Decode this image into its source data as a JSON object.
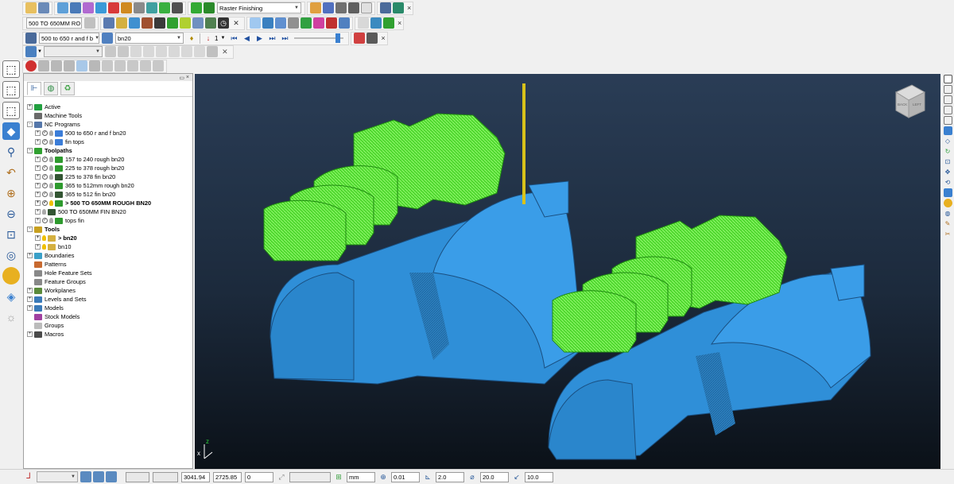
{
  "toolbar1": {
    "strategy_dropdown": "Raster Finishing"
  },
  "toolbar2": {
    "toolpath_dropdown": "500 TO 650MM RO"
  },
  "toolbar3": {
    "ncprogram_dropdown": "500 to 650 r and f b",
    "tool_dropdown": "bn20",
    "step_value": "1"
  },
  "explorer": {
    "tabs": [
      "explorer-tab",
      "web-tab",
      "recycle-tab"
    ],
    "tree": [
      {
        "label": "Active",
        "level": 0,
        "icon": "#22a040",
        "expander": "+"
      },
      {
        "label": "Machine Tools",
        "level": 0,
        "icon": "#6a6a6a",
        "expander": ""
      },
      {
        "label": "NC Programs",
        "level": 0,
        "icon": "#5577aa",
        "expander": "-"
      },
      {
        "label": "500 to 650 r and f bn20",
        "level": 1,
        "icon": "#3b7dd8",
        "expander": "+",
        "check": true,
        "bulb": false
      },
      {
        "label": "fin tops",
        "level": 1,
        "icon": "#3b7dd8",
        "expander": "+",
        "check": true,
        "bulb": false
      },
      {
        "label": "Toolpaths",
        "level": 0,
        "icon": "#30a030",
        "expander": "-",
        "bold": true
      },
      {
        "label": "157 to 240 rough bn20",
        "level": 1,
        "icon": "#2e9a2e",
        "expander": "+",
        "check": true,
        "bulb": false
      },
      {
        "label": "225 to 378 rough bn20",
        "level": 1,
        "icon": "#2e9a2e",
        "expander": "+",
        "check": true,
        "bulb": false
      },
      {
        "label": "225 to 378 fin bn20",
        "level": 1,
        "icon": "#335533",
        "expander": "+",
        "check": true,
        "bulb": false
      },
      {
        "label": "365 to 512mm rough bn20",
        "level": 1,
        "icon": "#2e9a2e",
        "expander": "+",
        "check": true,
        "bulb": false
      },
      {
        "label": "365 to 512 fin bn20",
        "level": 1,
        "icon": "#335533",
        "expander": "+",
        "check": true,
        "bulb": false
      },
      {
        "label": "> 500 TO 650MM ROUGH BN20",
        "level": 1,
        "icon": "#2e9a2e",
        "expander": "+",
        "check": true,
        "bulb": true,
        "bold": true
      },
      {
        "label": "500 TO 650MM FIN BN20",
        "level": 1,
        "icon": "#335533",
        "expander": "+",
        "check": false,
        "bulb": false
      },
      {
        "label": "tops fin",
        "level": 1,
        "icon": "#2e9a2e",
        "expander": "+",
        "check": true,
        "bulb": false
      },
      {
        "label": "Tools",
        "level": 0,
        "icon": "#c8a020",
        "expander": "-",
        "bold": true
      },
      {
        "label": "> bn20",
        "level": 1,
        "icon": "#d4b040",
        "expander": "+",
        "check": false,
        "bulb": true,
        "bold": true
      },
      {
        "label": "bn10",
        "level": 1,
        "icon": "#d4b040",
        "expander": "+",
        "check": false,
        "bulb": true
      },
      {
        "label": "Boundaries",
        "level": 0,
        "icon": "#3aa0c8",
        "expander": "+"
      },
      {
        "label": "Patterns",
        "level": 0,
        "icon": "#c86a30",
        "expander": ""
      },
      {
        "label": "Hole Feature Sets",
        "level": 0,
        "icon": "#888888",
        "expander": ""
      },
      {
        "label": "Feature Groups",
        "level": 0,
        "icon": "#888888",
        "expander": ""
      },
      {
        "label": "Workplanes",
        "level": 0,
        "icon": "#5a8a3a",
        "expander": "+"
      },
      {
        "label": "Levels and Sets",
        "level": 0,
        "icon": "#3a7ab8",
        "expander": "+"
      },
      {
        "label": "Models",
        "level": 0,
        "icon": "#3a7ab8",
        "expander": "+"
      },
      {
        "label": "Stock Models",
        "level": 0,
        "icon": "#a040a0",
        "expander": ""
      },
      {
        "label": "Groups",
        "level": 0,
        "icon": "#bbbbbb",
        "expander": ""
      },
      {
        "label": "Macros",
        "level": 0,
        "icon": "#4a4a4a",
        "expander": "+"
      }
    ]
  },
  "viewcube": {
    "face_left": "BACK",
    "face_right": "LEFT"
  },
  "triad": {
    "z": "z",
    "x": "x"
  },
  "status": {
    "coord_x": "3041.94",
    "coord_y": "2725.85",
    "coord_z": "0",
    "units": "mm",
    "tolerance": "0.01",
    "thickness": "2.0",
    "diameter": "20.0",
    "stepover": "10.0"
  },
  "colors": {
    "viewport_top": "#2a3d56",
    "viewport_bottom": "#0b1118",
    "model_blue": "#2f8fd8",
    "toolpath_green": "#55ee33",
    "tool_yellow": "#d8c21a"
  }
}
